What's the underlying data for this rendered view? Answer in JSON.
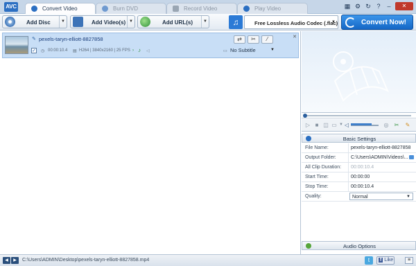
{
  "app": {
    "logo_text": "AVC"
  },
  "tabs": [
    {
      "label": "Convert Video",
      "icon": "convert-video-icon",
      "active": true
    },
    {
      "label": "Burn DVD",
      "icon": "disc-icon",
      "active": false
    },
    {
      "label": "Record Video",
      "icon": "record-icon",
      "active": false
    },
    {
      "label": "Play Video",
      "icon": "play-icon",
      "active": false
    }
  ],
  "window_buttons": [
    "grid-icon",
    "gear-icon",
    "refresh-icon",
    "help-icon",
    "minimize-icon",
    "close-icon"
  ],
  "toolbar": {
    "add_disc": "Add Disc",
    "add_videos": "Add Video(s)",
    "add_urls": "Add URL(s)",
    "output_format": "Free Lossless Audio Codec (.flac)",
    "convert_now": "Convert Now!"
  },
  "file": {
    "name": "pexels-taryn-elliott-8827858",
    "duration": "00:00:10.4",
    "codec_info": "H264 | 3840x2160 | 25 FPS",
    "subtitle": "No Subtitle",
    "checked": true
  },
  "settings": {
    "header": "Basic Settings",
    "rows": [
      {
        "key": "File Name:",
        "value": "pexels-taryn-elliott-8827858"
      },
      {
        "key": "Output Folder:",
        "value": "C:\\Users\\ADMIN\\Videos\\..."
      },
      {
        "key": "All Clip Duration:",
        "value": "00:00:10.4"
      },
      {
        "key": "Start Time:",
        "value": "00:00:00"
      },
      {
        "key": "Stop Time:",
        "value": "00:00:10.4"
      },
      {
        "key": "Quality:",
        "value": "Normal"
      }
    ],
    "audio_header": "Audio Options"
  },
  "status": {
    "path": "C:\\Users\\ADMIN\\Desktop\\pexels-taryn-elliott-8827858.mp4",
    "facebook_like": "Like"
  },
  "colors": {
    "accent": "#1a6fd0",
    "row_selected": "#c8def6",
    "titlebar": "#c6d6e8"
  }
}
